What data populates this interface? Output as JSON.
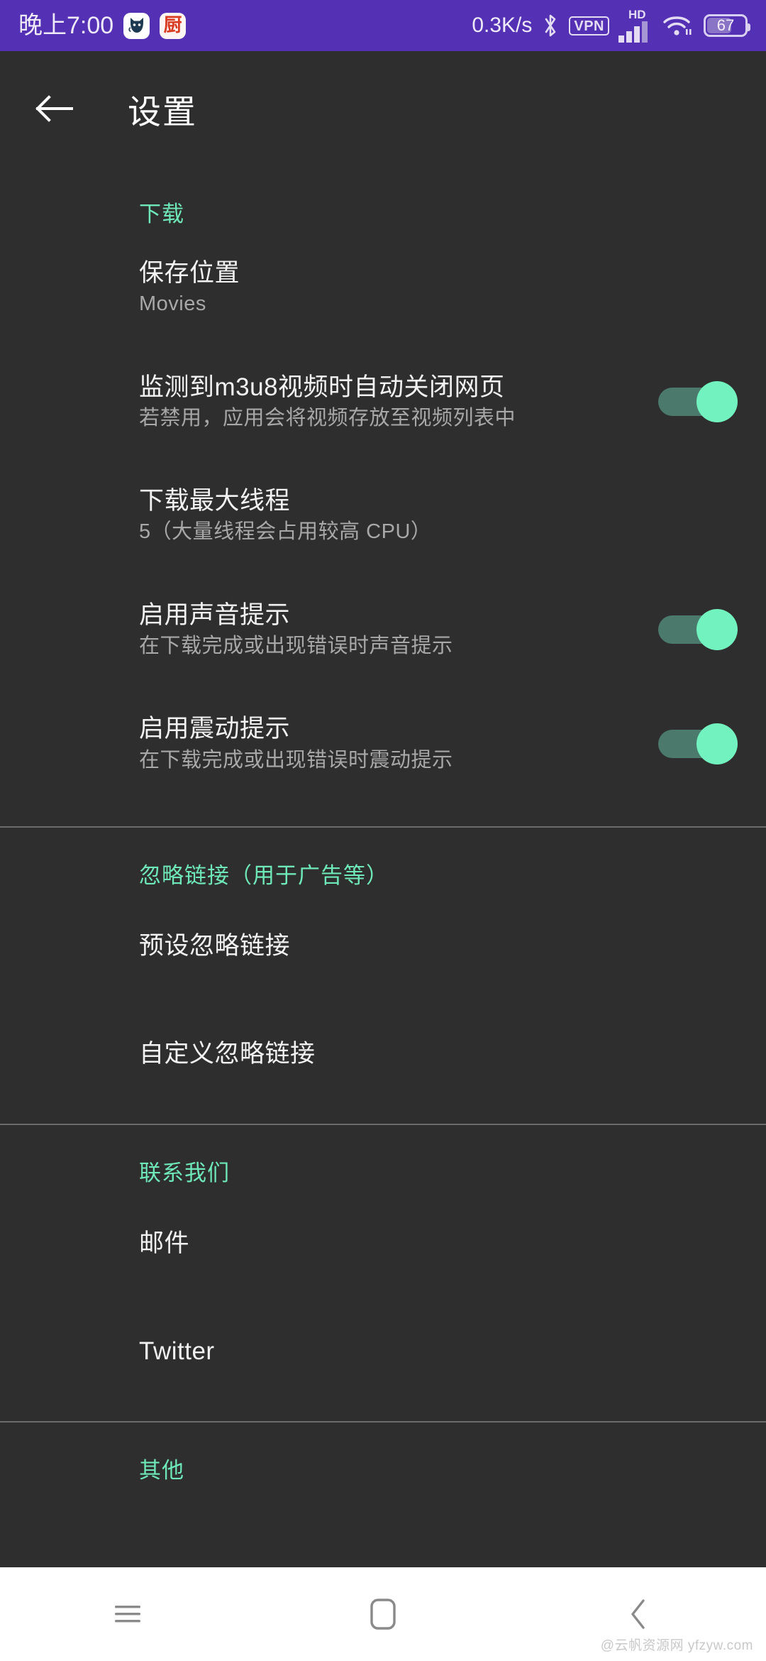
{
  "status_bar": {
    "clock": "晚上7:00",
    "app_icons": [
      {
        "name": "cat-app-icon",
        "glyph": ""
      },
      {
        "name": "kitchen-app-icon",
        "glyph": "厨"
      }
    ],
    "network_speed": "0.3K/s",
    "bluetooth": "bluetooth-icon",
    "vpn_label": "VPN",
    "hd_label": "HD",
    "signal": "signal-bars-icon",
    "wifi": "wifi-icon",
    "battery_level": "67",
    "background_color": "#5430b4"
  },
  "app_bar": {
    "back": "back-arrow-icon",
    "title": "设置"
  },
  "theme": {
    "accent": "#6ee8b8",
    "background": "#2e2e2e",
    "switch_on_thumb": "#72f2bf",
    "switch_on_track": "#4b7a6d"
  },
  "sections": [
    {
      "header": "下载",
      "rows": [
        {
          "title": "保存位置",
          "subtitle": "Movies",
          "type": "value"
        },
        {
          "title": "监测到m3u8视频时自动关闭网页",
          "subtitle": "若禁用，应用会将视频存放至视频列表中",
          "type": "switch",
          "checked": true
        },
        {
          "title": "下载最大线程",
          "subtitle": "5（大量线程会占用较高 CPU）",
          "type": "value"
        },
        {
          "title": "启用声音提示",
          "subtitle": "在下载完成或出现错误时声音提示",
          "type": "switch",
          "checked": true
        },
        {
          "title": "启用震动提示",
          "subtitle": "在下载完成或出现错误时震动提示",
          "type": "switch",
          "checked": true
        }
      ]
    },
    {
      "header": "忽略链接（用于广告等）",
      "rows": [
        {
          "title": "预设忽略链接",
          "subtitle": "",
          "type": "nav"
        },
        {
          "title": "自定义忽略链接",
          "subtitle": "",
          "type": "nav"
        }
      ]
    },
    {
      "header": "联系我们",
      "rows": [
        {
          "title": "邮件",
          "subtitle": "",
          "type": "nav"
        },
        {
          "title": "Twitter",
          "subtitle": "",
          "type": "nav"
        }
      ]
    },
    {
      "header": "其他",
      "rows": []
    }
  ],
  "nav_bar": {
    "recents": "menu-icon",
    "home": "home-square-icon",
    "back": "chevron-left-icon"
  },
  "watermark": "@云帆资源网 yfzyw.com"
}
